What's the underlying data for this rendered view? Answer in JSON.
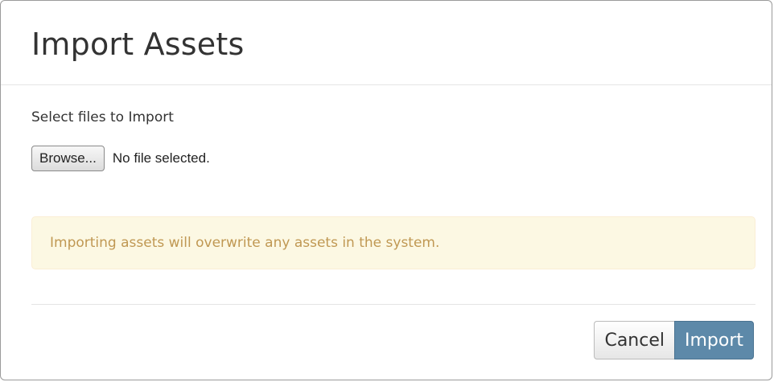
{
  "dialog": {
    "title": "Import Assets",
    "select_label": "Select files to Import",
    "file_input": {
      "browse_label": "Browse...",
      "status": "No file selected."
    },
    "warning": "Importing assets will overwrite any assets in the system.",
    "actions": {
      "cancel_label": "Cancel",
      "import_label": "Import"
    }
  },
  "colors": {
    "warning_bg": "#fcf8e3",
    "warning_text": "#c09853",
    "primary": "#5d89a9"
  }
}
